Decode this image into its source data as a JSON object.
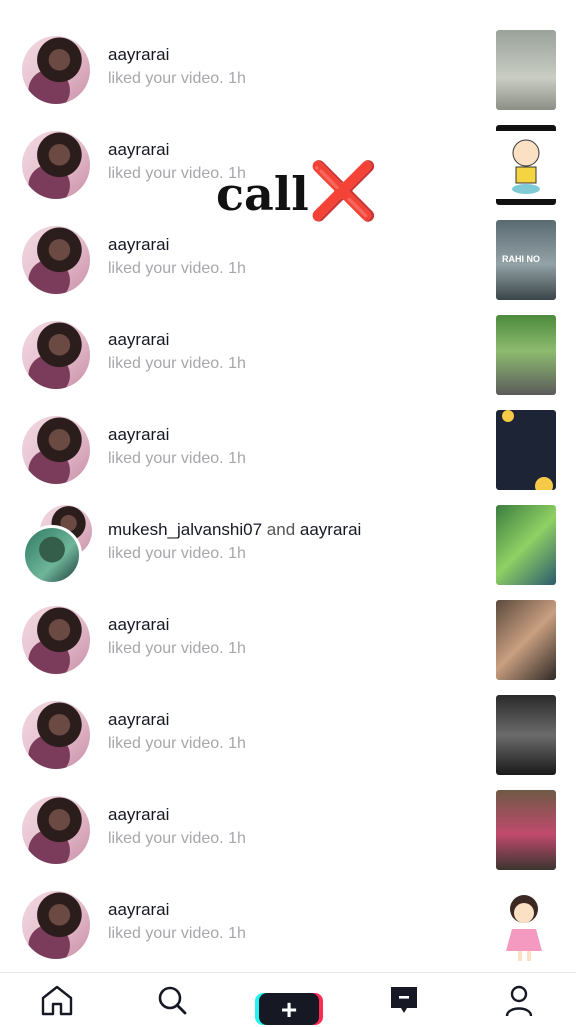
{
  "notifications": [
    {
      "name": "aayrarai",
      "and": "",
      "name2": "",
      "action": "liked your video. 1h"
    },
    {
      "name": "aayrarai",
      "and": "",
      "name2": "",
      "action": "liked your video. 1h"
    },
    {
      "name": "aayrarai",
      "and": "",
      "name2": "",
      "action": "liked your video. 1h"
    },
    {
      "name": "aayrarai",
      "and": "",
      "name2": "",
      "action": "liked your video. 1h"
    },
    {
      "name": "aayrarai",
      "and": "",
      "name2": "",
      "action": "liked your video. 1h"
    },
    {
      "name": "mukesh_jalvanshi07",
      "and": "and",
      "name2": "aayrarai",
      "action": "liked your video. 1h"
    },
    {
      "name": "aayrarai",
      "and": "",
      "name2": "",
      "action": "liked your video. 1h"
    },
    {
      "name": "aayrarai",
      "and": "",
      "name2": "",
      "action": "liked your video. 1h"
    },
    {
      "name": "aayrarai",
      "and": "",
      "name2": "",
      "action": "liked your video. 1h"
    },
    {
      "name": "aayrarai",
      "and": "",
      "name2": "",
      "action": "liked your video. 1h"
    }
  ],
  "overlay": {
    "text": "call",
    "mark": "❌"
  },
  "thumb_caption": "RAHI NO",
  "tabbar": {
    "icons": [
      "home-icon",
      "search-icon",
      "create-plus-icon",
      "inbox-icon",
      "profile-icon"
    ],
    "plus_symbol": "+"
  },
  "colors": {
    "accent_red": "#fe2c55",
    "accent_cyan": "#25f4ee",
    "text": "#161823",
    "subtext": "#a6a7ab"
  }
}
